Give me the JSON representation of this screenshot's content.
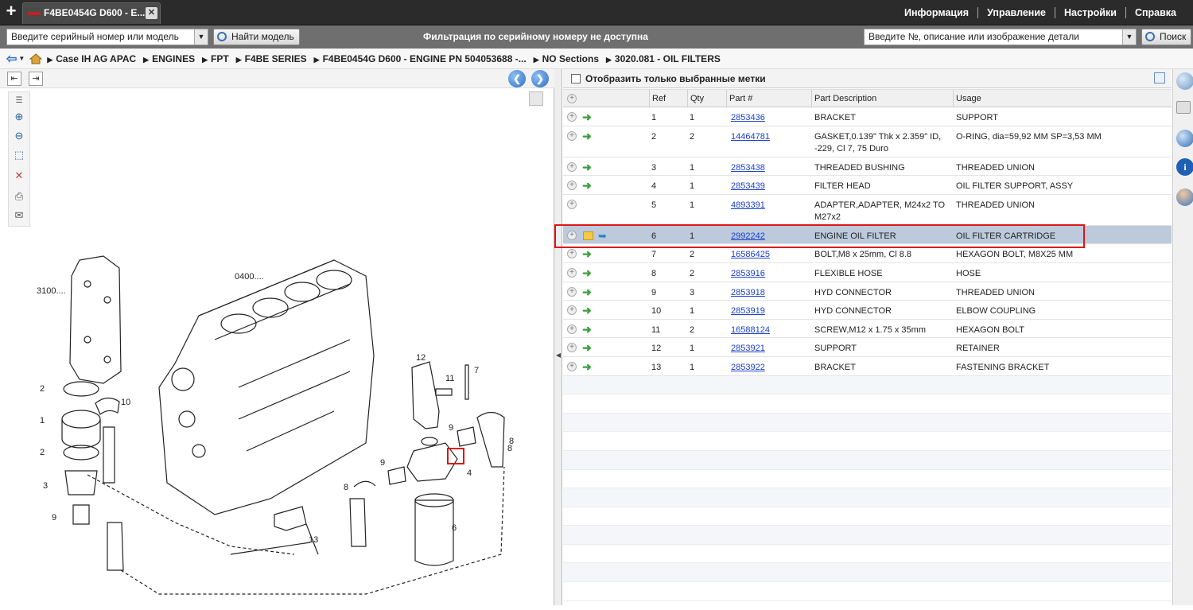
{
  "tab": {
    "title": "F4BE0454G D600 - E...",
    "close": "✕",
    "add": "+"
  },
  "top_menu": [
    "Информация",
    "Управление",
    "Настройки",
    "Справка"
  ],
  "search": {
    "serial_placeholder": "Введите серийный номер или модель",
    "find_model_label": "Найти модель",
    "filter_message": "Фильтрация по серийному номеру не доступна",
    "part_placeholder": "Введите №, описание или изображение детали",
    "search_label": "Поиск"
  },
  "breadcrumbs": [
    "Case IH AG APAC",
    "ENGINES",
    "FPT",
    "F4BE SERIES",
    "F4BE0454G D600 - ENGINE PN 504053688 -...",
    "NO Sections",
    "3020.081 - OIL FILTERS"
  ],
  "right_header": {
    "show_selected_label": "Отобразить только выбранные метки"
  },
  "table": {
    "columns": [
      "Ref",
      "Qty",
      "Part #",
      "Part Description",
      "Usage"
    ],
    "rows": [
      {
        "ref": "1",
        "qty": "1",
        "part": "2853436",
        "desc": "BRACKET",
        "usage": "SUPPORT",
        "icon": "arrow"
      },
      {
        "ref": "2",
        "qty": "2",
        "part": "14464781",
        "desc": "GASKET,0.139\" Thk x 2.359\" ID, -229, Cl 7, 75 Duro",
        "usage": "O-RING, dia=59,92 MM SP=3,53 MM",
        "icon": "arrow"
      },
      {
        "ref": "3",
        "qty": "1",
        "part": "2853438",
        "desc": "THREADED BUSHING",
        "usage": "THREADED UNION",
        "icon": "arrow"
      },
      {
        "ref": "4",
        "qty": "1",
        "part": "2853439",
        "desc": "FILTER HEAD",
        "usage": "OIL FILTER SUPPORT, ASSY",
        "icon": "arrow"
      },
      {
        "ref": "5",
        "qty": "1",
        "part": "4893391",
        "desc": "ADAPTER,ADAPTER, M24x2 TO M27x2",
        "usage": "THREADED UNION",
        "icon": "none"
      },
      {
        "ref": "6",
        "qty": "1",
        "part": "2992242",
        "desc": "ENGINE OIL FILTER",
        "usage": "OIL FILTER CARTRIDGE",
        "icon": "note"
      },
      {
        "ref": "7",
        "qty": "2",
        "part": "16586425",
        "desc": "BOLT,M8 x 25mm, Cl 8.8",
        "usage": "HEXAGON BOLT, M8X25 MM",
        "icon": "arrow"
      },
      {
        "ref": "8",
        "qty": "2",
        "part": "2853916",
        "desc": "FLEXIBLE HOSE",
        "usage": "HOSE",
        "icon": "arrow"
      },
      {
        "ref": "9",
        "qty": "3",
        "part": "2853918",
        "desc": "HYD CONNECTOR",
        "usage": "THREADED UNION",
        "icon": "arrow"
      },
      {
        "ref": "10",
        "qty": "1",
        "part": "2853919",
        "desc": "HYD CONNECTOR",
        "usage": "ELBOW COUPLING",
        "icon": "arrow"
      },
      {
        "ref": "11",
        "qty": "2",
        "part": "16588124",
        "desc": "SCREW,M12 x 1.75 x 35mm",
        "usage": "HEXAGON BOLT",
        "icon": "arrow"
      },
      {
        "ref": "12",
        "qty": "1",
        "part": "2853921",
        "desc": "SUPPORT",
        "usage": "RETAINER",
        "icon": "arrow"
      },
      {
        "ref": "13",
        "qty": "1",
        "part": "2853922",
        "desc": "BRACKET",
        "usage": "FASTENING BRACKET",
        "icon": "arrow"
      }
    ],
    "selected_ref": "6"
  },
  "drawing": {
    "labels": [
      "3100....",
      "0400....",
      "1",
      "2",
      "2",
      "3",
      "9",
      "10",
      "12",
      "11",
      "7",
      "9",
      "9",
      "8",
      "4",
      "8",
      "8",
      "6",
      "13"
    ]
  },
  "colors": {
    "topbar": "#2b2b2b",
    "highlight": "#e01414",
    "link": "#1a3fd0",
    "selected_row": "#bccadb"
  }
}
